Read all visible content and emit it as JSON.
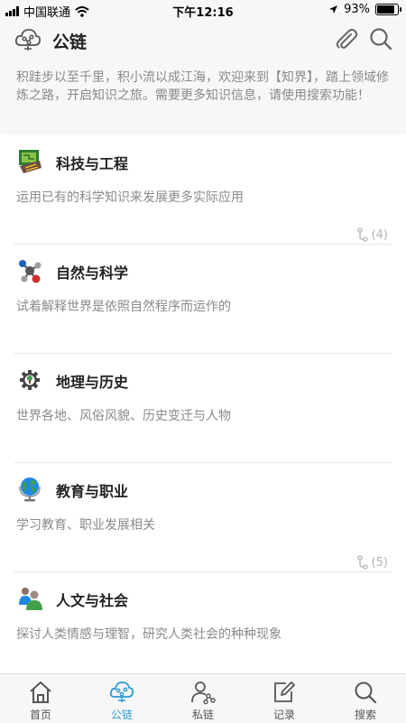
{
  "status_bar": {
    "carrier": "中国联通",
    "time": "下午12:16",
    "battery": "93%",
    "battery_level": 0.93
  },
  "header": {
    "title": "公链",
    "logo_icon": "cloud-network-icon",
    "attach_icon": "paperclip-icon",
    "search_icon": "search-icon"
  },
  "intro": {
    "text": "积跬步以至千里，积小流以成江海，欢迎来到【知界】，踏上领域修炼之路，开启知识之旅。需要更多知识信息，请使用搜索功能！"
  },
  "categories": [
    {
      "name": "科技与工程",
      "desc": "运用已有的科学知识来发展更多实际应用",
      "count": "(4)",
      "icon": "circuit-board-icon"
    },
    {
      "name": "自然与科学",
      "desc": "试着解释世界是依照自然程序而运作的",
      "count": "",
      "icon": "molecule-icon"
    },
    {
      "name": "地理与历史",
      "desc": "世界各地、风俗风貌、历史变迁与人物",
      "count": "",
      "icon": "gear-tree-icon"
    },
    {
      "name": "教育与职业",
      "desc": "学习教育、职业发展相关",
      "count": "(5)",
      "icon": "globe-icon"
    },
    {
      "name": "人文与社会",
      "desc": "探讨人类情感与理智，研究人类社会的种种现象",
      "count": "",
      "icon": "people-icon"
    }
  ],
  "tabs": [
    {
      "label": "首页",
      "icon": "home-icon"
    },
    {
      "label": "公链",
      "icon": "cloud-network-icon"
    },
    {
      "label": "私链",
      "icon": "user-network-icon"
    },
    {
      "label": "记录",
      "icon": "edit-icon"
    },
    {
      "label": "搜索",
      "icon": "search-icon"
    }
  ],
  "colors": {
    "accent": "#2b9bd6",
    "text_secondary": "#8a8a8a",
    "background_bar": "#f7f7f7"
  }
}
